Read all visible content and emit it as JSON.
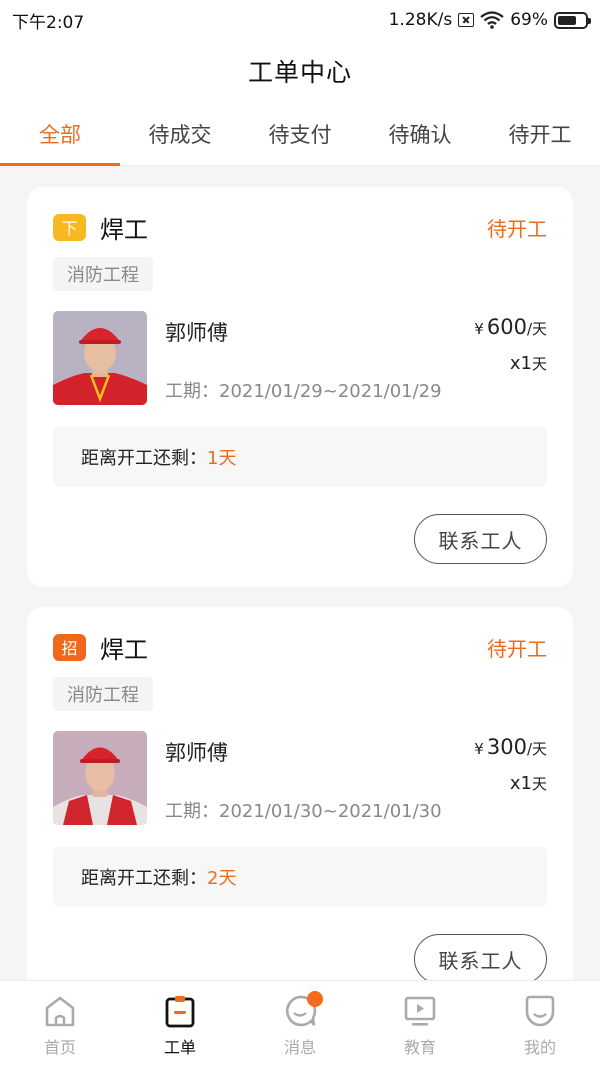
{
  "status_bar": {
    "time": "下午2:07",
    "network_speed": "1.28K/s",
    "battery": "69%",
    "battery_level": 0.69
  },
  "header": {
    "title": "工单中心"
  },
  "tabs": [
    {
      "label": "全部",
      "active": true
    },
    {
      "label": "待成交",
      "active": false
    },
    {
      "label": "待支付",
      "active": false
    },
    {
      "label": "待确认",
      "active": false
    },
    {
      "label": "待开工",
      "active": false
    }
  ],
  "orders": [
    {
      "badge": "下",
      "badge_color": "#f8b820",
      "job": "焊工",
      "status": "待开工",
      "tag": "消防工程",
      "worker_name": "郭师傅",
      "currency": "¥",
      "price": "600",
      "price_unit": "/天",
      "quantity": "x1",
      "quantity_unit": "天",
      "period": "工期：2021/01/29~2021/01/29",
      "countdown_label": "距离开工还剩：",
      "countdown_value": "1天",
      "contact_label": "联系工人"
    },
    {
      "badge": "招",
      "badge_color": "#f0681c",
      "job": "焊工",
      "status": "待开工",
      "tag": "消防工程",
      "worker_name": "郭师傅",
      "currency": "¥",
      "price": "300",
      "price_unit": "/天",
      "quantity": "x1",
      "quantity_unit": "天",
      "period": "工期：2021/01/30~2021/01/30",
      "countdown_label": "距离开工还剩：",
      "countdown_value": "2天",
      "contact_label": "联系工人"
    }
  ],
  "bottom_nav": [
    {
      "label": "首页",
      "icon": "home-icon",
      "active": false
    },
    {
      "label": "工单",
      "icon": "work-order-icon",
      "active": true
    },
    {
      "label": "消息",
      "icon": "message-icon",
      "active": false,
      "has_notification": true
    },
    {
      "label": "教育",
      "icon": "education-icon",
      "active": false
    },
    {
      "label": "我的",
      "icon": "profile-icon",
      "active": false
    }
  ],
  "colors": {
    "accent": "#ee6b1e",
    "badge_xia": "#f8b820",
    "badge_zhao": "#f0681c"
  }
}
